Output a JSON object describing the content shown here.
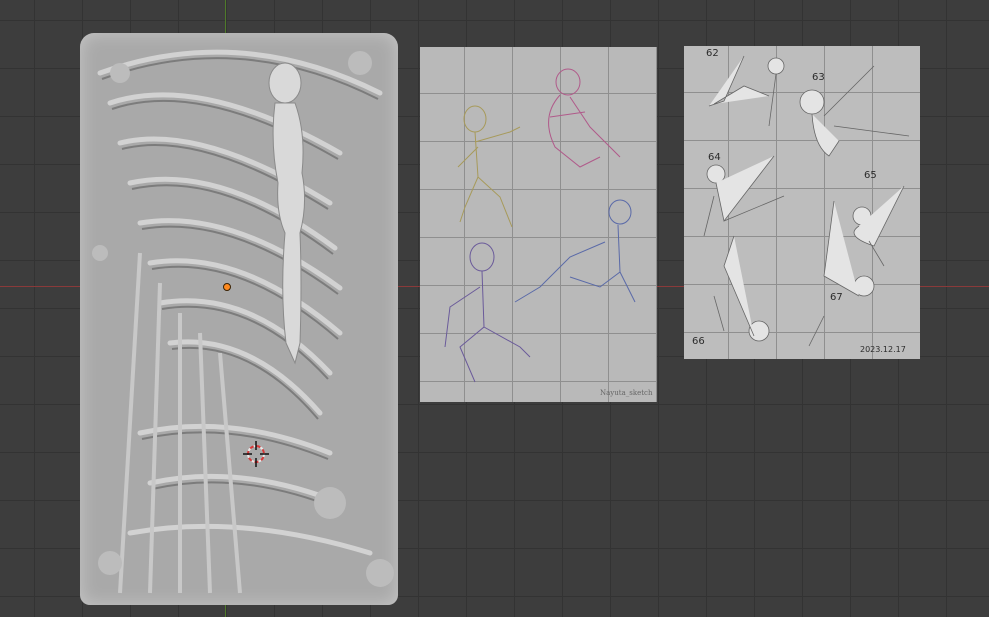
{
  "viewport": {
    "background": "#3d3d3d",
    "grid_color": "#333333",
    "x_axis_color": "#8a3a3a",
    "y_axis_color": "#4f7a2a"
  },
  "objects": {
    "relief_panel": {
      "icon": "sculpted-relief-mesh"
    },
    "reference_sheet_1": {
      "signature": "Nayuta_sketch",
      "icon": "figure-sketches"
    },
    "reference_sheet_2": {
      "pose_numbers": [
        "62",
        "63",
        "64",
        "65",
        "66",
        "67"
      ],
      "date": "2023.12.17",
      "icon": "figure-pose-sketches"
    }
  },
  "gizmos": {
    "cursor": "3d-cursor-icon",
    "origin": "origin-dot-icon",
    "origin_color": "#ff8a1f"
  }
}
